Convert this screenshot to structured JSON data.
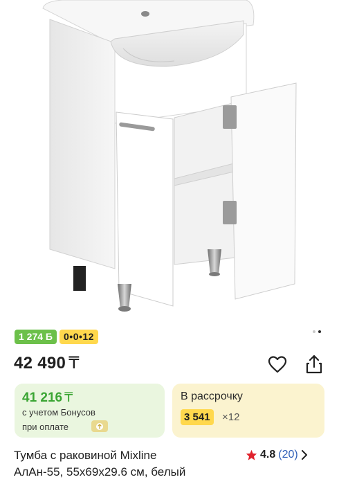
{
  "product": {
    "image_alt": "Тумба с раковиной Mixline АлАн-55",
    "carousel": {
      "total": 2,
      "active": 1
    },
    "badges": {
      "bonus": "1 274 Б",
      "installment": "0•0•12"
    },
    "price": {
      "amount": "42 490",
      "currency": "₸"
    },
    "bonus_card": {
      "amount": "41 216",
      "currency": "₸",
      "note_line1": "с учетом Бонусов",
      "note_line2": "при оплате"
    },
    "credit_card": {
      "title": "В рассрочку",
      "monthly": "3 541",
      "term": "×12"
    },
    "title_line1": "Тумба с раковиной Mixline",
    "title_line2": "АлАн-55, 55х69х29.6 см, белый",
    "rating": {
      "score": "4.8",
      "count": "(20)"
    }
  },
  "colors": {
    "bonus_green": "#6cc04a",
    "installment_yellow": "#ffd84d",
    "link_blue": "#2f5fb8",
    "star_red": "#e0222c"
  }
}
